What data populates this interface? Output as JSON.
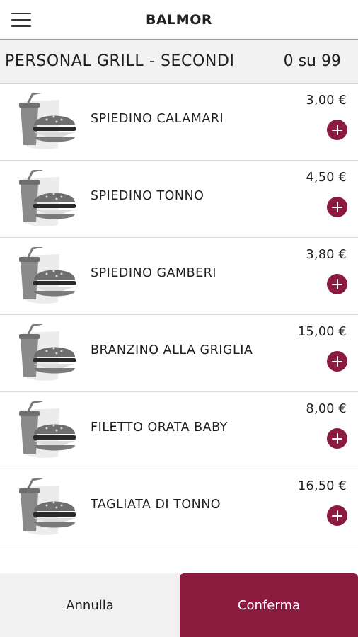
{
  "header": {
    "title": "BALMOR",
    "menu_icon": "hamburger-menu-icon"
  },
  "category": {
    "title": "PERSONAL GRILL - SECONDI",
    "count": "0 su 99"
  },
  "items": [
    {
      "name": "SPIEDINO CALAMARI",
      "price": "3,00 €"
    },
    {
      "name": "SPIEDINO TONNO",
      "price": "4,50 €"
    },
    {
      "name": "SPIEDINO GAMBERI",
      "price": "3,80 €"
    },
    {
      "name": "BRANZINO ALLA GRIGLIA",
      "price": "15,00 €"
    },
    {
      "name": "FILETTO ORATA BABY",
      "price": "8,00 €"
    },
    {
      "name": "TAGLIATA DI TONNO",
      "price": "16,50 €"
    }
  ],
  "item_image_icon": "burger-and-drink-icon",
  "add_icon": "plus-circle-icon",
  "footer": {
    "cancel_label": "Annulla",
    "confirm_label": "Conferma"
  },
  "colors": {
    "accent": "#8a1a3e",
    "footer_cancel_bg": "#f1f1f1",
    "category_bar_bg": "#f2f2f2"
  }
}
